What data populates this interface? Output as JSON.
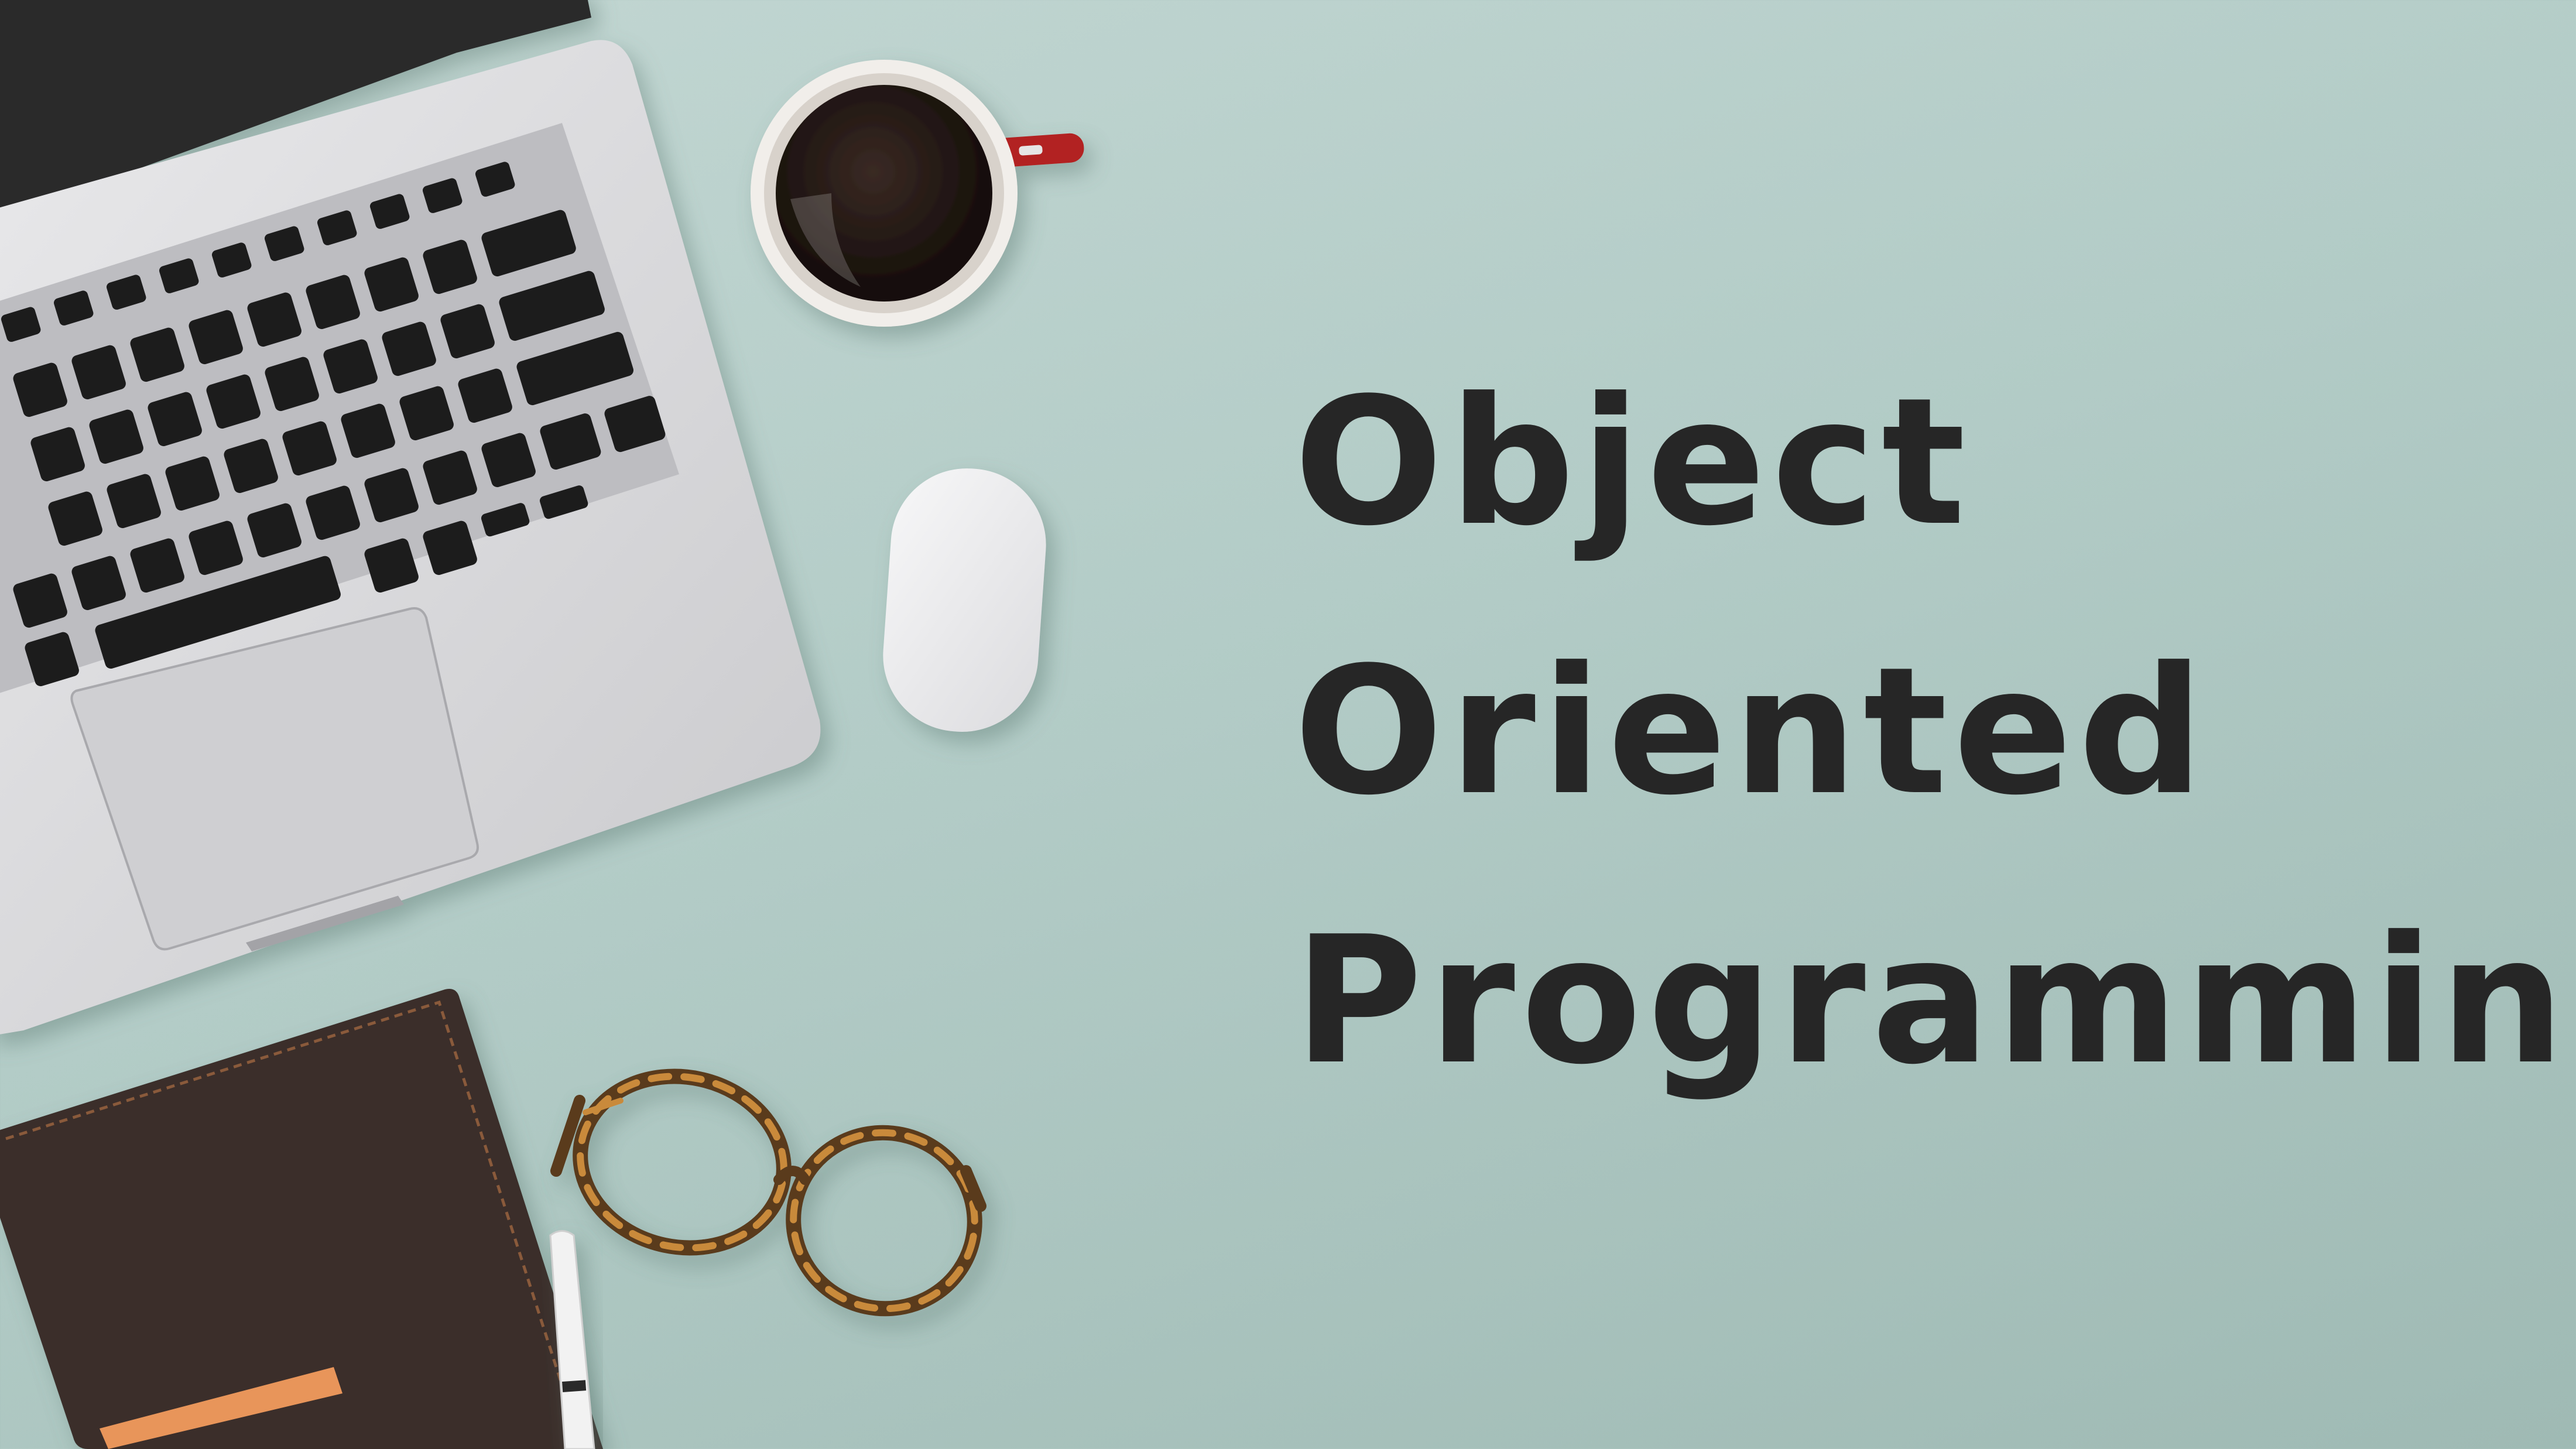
{
  "title": {
    "lines": [
      "Object",
      "Oriented",
      "Programming"
    ]
  },
  "colors": {
    "background": "#b3ccc7",
    "text": "#262626",
    "laptop_body": "#d9d9db",
    "keys": "#1c1c1e",
    "cup_handle": "#b22222",
    "notebook": "#3a2f2b",
    "notebook_strap": "#e8955a"
  },
  "icons": [
    "laptop-icon",
    "coffee-cup-icon",
    "mouse-icon",
    "notebook-icon",
    "glasses-icon",
    "pen-icon"
  ]
}
